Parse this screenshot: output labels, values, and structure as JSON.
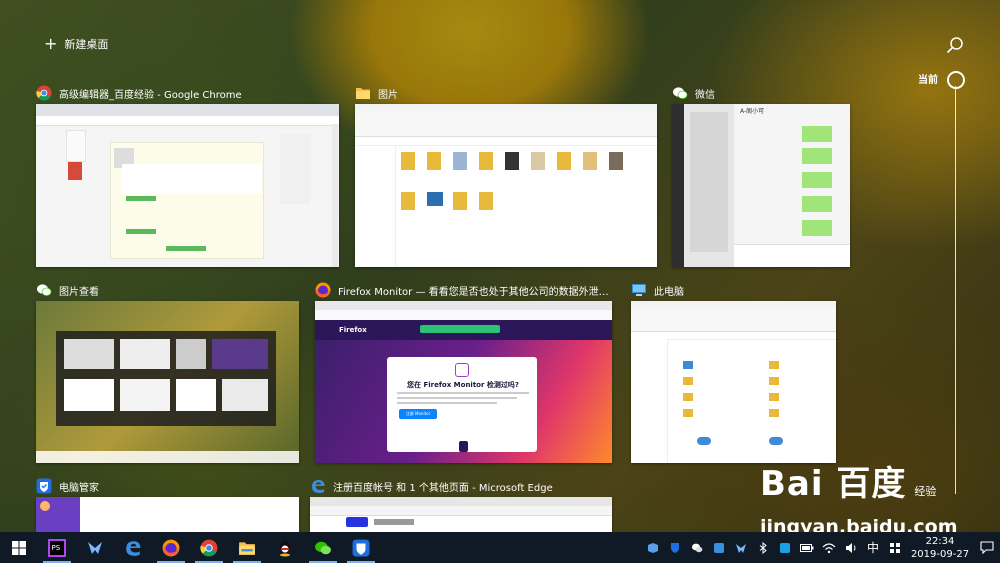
{
  "new_desktop_label": "新建桌面",
  "timeline_label": "当前",
  "windows": [
    {
      "title": "高级编辑器_百度经验 - Google Chrome",
      "icon": "chrome-icon"
    },
    {
      "title": "图片",
      "icon": "folder-icon"
    },
    {
      "title": "微信",
      "icon": "wechat-icon"
    },
    {
      "title": "图片查看",
      "icon": "wechat-icon"
    },
    {
      "title": "Firefox Monitor — 看看您是否也处于其他公司的数据外泄…",
      "icon": "firefox-icon"
    },
    {
      "title": "此电脑",
      "icon": "this-pc-icon"
    },
    {
      "title": "电脑管家",
      "icon": "pc-manager-icon"
    },
    {
      "title": "注册百度帐号 和 1 个其他页面 - Microsoft Edge",
      "icon": "edge-icon"
    }
  ],
  "firefox_thumb": {
    "logo_text": "Firefox",
    "heading": "您在 Firefox Monitor 检测过吗?",
    "button": "注册 Monitor"
  },
  "wechat_thumb": {
    "contact": "A-阁小可"
  },
  "taskbar": {
    "pinned": [
      "start-icon",
      "phpstorm-icon",
      "xmind-icon",
      "edge-icon",
      "firefox-icon",
      "chrome-icon",
      "file-explorer-icon",
      "qq-icon",
      "wechat-icon",
      "pc-manager-icon"
    ],
    "ime": "中",
    "time": "22:34",
    "date": "2019-09-27"
  },
  "watermark": {
    "brand": "Bai 百度",
    "suffix": "经验",
    "site": "jingyan.baidu.com"
  },
  "colors": {
    "taskbar": "#0f1a26",
    "firefox_purple": "#3b1f6b",
    "accent": "#0a84ff"
  }
}
